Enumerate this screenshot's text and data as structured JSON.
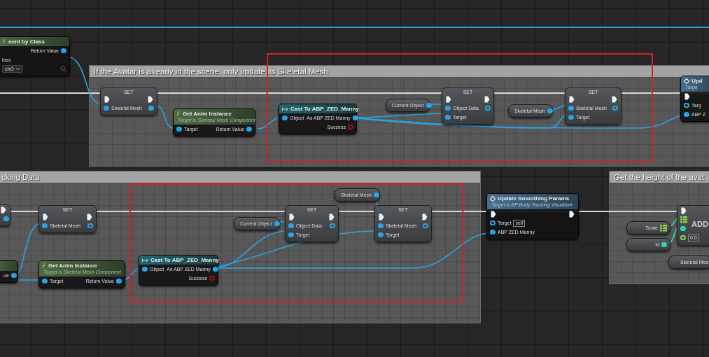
{
  "comments": [
    {
      "title": "If the Avatar is already in the scene, only update its Skeletal Mesh"
    },
    {
      "title": "cking Data"
    },
    {
      "title": "Get the height of the avat"
    }
  ],
  "nodes": [
    {
      "kind": "function",
      "title": "nent by Class",
      "exec_in": false,
      "exec_out": false,
      "rows": [
        {
          "out": {
            "label": "Return Value",
            "kind": "dot",
            "color": "#28a4e6",
            "connected": true
          }
        },
        {
          "in": {
            "label": "lass"
          }
        },
        {
          "dropdown": "chO"
        }
      ]
    },
    {
      "kind": "set",
      "title": "SET",
      "exec_in": true,
      "exec_out": true,
      "rows": [
        {
          "in": {
            "label": "Skeletal Mesh",
            "kind": "dot",
            "color": "#28a4e6",
            "connected": true
          },
          "out": {
            "kind": "dot",
            "color": "#28a4e6",
            "connected": true
          }
        }
      ]
    },
    {
      "kind": "function",
      "title": "Get Anim Instance",
      "subtitle": "Target is Skeletal Mesh Component",
      "exec_in": false,
      "exec_out": false,
      "rows": [
        {
          "in": {
            "label": "Target",
            "kind": "dot",
            "color": "#28a4e6",
            "connected": true
          },
          "out": {
            "label": "Return Value",
            "kind": "dot",
            "color": "#28a4e6",
            "connected": true
          }
        }
      ]
    },
    {
      "kind": "cast",
      "title": "Cast To ABP_ZED_Manny",
      "exec_in": false,
      "exec_out": false,
      "rows": [
        {
          "in": {
            "label": "Object",
            "kind": "dot",
            "color": "#28a4e6",
            "connected": true
          },
          "out": {
            "label": "As ABP ZED Manny",
            "kind": "dot",
            "color": "#28a4e6",
            "connected": true
          }
        },
        {
          "out": {
            "label": "Success",
            "kind": "dot",
            "color": "#9a1010",
            "connected": false
          }
        }
      ]
    },
    {
      "kind": "variable",
      "exec_in": false,
      "exec_out": false,
      "rows": [
        {
          "out": {
            "label": "Current Object",
            "kind": "dot",
            "color": "#28a4e6",
            "connected": true
          }
        }
      ]
    },
    {
      "kind": "set",
      "title": "SET",
      "exec_in": true,
      "exec_out": true,
      "rows": [
        {
          "in": {
            "label": "Object Data",
            "kind": "dot",
            "color": "#28a4e6",
            "connected": true
          },
          "out": {
            "kind": "dot",
            "color": "#28a4e6",
            "connected": false
          }
        },
        {
          "in": {
            "label": "Target",
            "kind": "dot",
            "color": "#28a4e6",
            "connected": true
          }
        }
      ]
    },
    {
      "kind": "variable",
      "exec_in": false,
      "exec_out": false,
      "rows": [
        {
          "out": {
            "label": "Skeletal Mesh",
            "kind": "dot",
            "color": "#28a4e6",
            "connected": true
          }
        }
      ]
    },
    {
      "kind": "set",
      "title": "SET",
      "exec_in": true,
      "exec_out": true,
      "rows": [
        {
          "in": {
            "label": "Skeletal Mesh",
            "kind": "dot",
            "color": "#28a4e6",
            "connected": true
          },
          "out": {
            "kind": "dot",
            "color": "#28a4e6",
            "connected": false
          }
        },
        {
          "in": {
            "label": "Target",
            "kind": "dot",
            "color": "#28a4e6",
            "connected": true
          }
        }
      ]
    },
    {
      "kind": "custom",
      "title": "Upd",
      "subtitle": "Targe",
      "exec_in": true,
      "exec_out": false,
      "rows": [
        {
          "in": {
            "label": "Targ",
            "kind": "dot",
            "color": "#28a4e6",
            "connected": false
          }
        },
        {
          "in": {
            "label": "ABP Z",
            "kind": "dot",
            "color": "#28a4e6",
            "connected": true
          }
        }
      ]
    },
    {
      "kind": "set",
      "exec_in": false,
      "exec_out": true,
      "rows": [
        {
          "out": {
            "kind": "dot",
            "color": "#28a4e6",
            "connected": true
          }
        }
      ]
    },
    {
      "kind": "function",
      "exec_in": false,
      "exec_out": false,
      "rows": [
        {
          "out": {
            "label": "ue",
            "kind": "dot",
            "color": "#28a4e6",
            "connected": true
          }
        }
      ]
    },
    {
      "kind": "set",
      "title": "SET",
      "exec_in": true,
      "exec_out": true,
      "rows": [
        {
          "in": {
            "label": "Skeletal Mesh",
            "kind": "dot",
            "color": "#28a4e6",
            "connected": true
          },
          "out": {
            "kind": "dot",
            "color": "#28a4e6",
            "connected": false
          }
        }
      ]
    },
    {
      "kind": "function",
      "title": "Get Anim Instance",
      "subtitle": "Target is Skeletal Mesh Component",
      "exec_in": false,
      "exec_out": false,
      "rows": [
        {
          "in": {
            "label": "Target",
            "kind": "dot",
            "color": "#28a4e6",
            "connected": true
          },
          "out": {
            "label": "Return Value",
            "kind": "dot",
            "color": "#28a4e6",
            "connected": true
          }
        }
      ]
    },
    {
      "kind": "cast",
      "title": "Cast To ABP_ZED_Manny",
      "exec_in": false,
      "exec_out": false,
      "rows": [
        {
          "in": {
            "label": "Object",
            "kind": "dot",
            "color": "#28a4e6",
            "connected": true
          },
          "out": {
            "label": "As ABP ZED Manny",
            "kind": "dot",
            "color": "#28a4e6",
            "connected": true
          }
        },
        {
          "out": {
            "label": "Success",
            "kind": "dot",
            "color": "#9a1010",
            "connected": false
          }
        }
      ]
    },
    {
      "kind": "variable",
      "exec_in": false,
      "exec_out": false,
      "rows": [
        {
          "out": {
            "label": "Current Object",
            "kind": "dot",
            "color": "#28a4e6",
            "connected": true
          }
        }
      ]
    },
    {
      "kind": "set",
      "title": "SET",
      "exec_in": true,
      "exec_out": true,
      "rows": [
        {
          "in": {
            "label": "Object Data",
            "kind": "dot",
            "color": "#28a4e6",
            "connected": true
          },
          "out": {
            "kind": "dot",
            "color": "#28a4e6",
            "connected": false
          }
        },
        {
          "in": {
            "label": "Target",
            "kind": "dot",
            "color": "#28a4e6",
            "connected": true
          }
        }
      ]
    },
    {
      "kind": "variable",
      "exec_in": false,
      "exec_out": false,
      "rows": [
        {
          "out": {
            "label": "Skeletal Mesh",
            "kind": "dot",
            "color": "#28a4e6",
            "connected": true
          }
        }
      ]
    },
    {
      "kind": "set",
      "title": "SET",
      "exec_in": true,
      "exec_out": true,
      "rows": [
        {
          "in": {
            "label": "Skeletal Mesh",
            "kind": "dot",
            "color": "#28a4e6",
            "connected": true
          },
          "out": {
            "kind": "dot",
            "color": "#28a4e6",
            "connected": false
          }
        },
        {
          "in": {
            "label": "Target",
            "kind": "dot",
            "color": "#28a4e6",
            "connected": true
          }
        }
      ]
    },
    {
      "kind": "custom",
      "title": "Update Smoothing Params",
      "subtitle": "Target is BP Body Tracking Visualizer",
      "exec_in": true,
      "exec_out": true,
      "rows": [
        {
          "in": {
            "label": "Target",
            "kind": "dot",
            "color": "#28a4e6",
            "connected": false,
            "default": "self"
          }
        },
        {
          "in": {
            "label": "ABP ZED Manny",
            "kind": "dot",
            "color": "#28a4e6",
            "connected": true
          }
        }
      ]
    },
    {
      "kind": "variable",
      "exec_in": false,
      "exec_out": false,
      "rows": [
        {
          "out": {
            "label": "Scale",
            "kind": "array",
            "color": "#8fd14f",
            "connected": true
          }
        }
      ]
    },
    {
      "kind": "variable",
      "exec_in": false,
      "exec_out": false,
      "rows": [
        {
          "out": {
            "label": "Id",
            "kind": "dot",
            "color": "#27d9b0",
            "connected": true
          }
        }
      ]
    },
    {
      "kind": "add",
      "title": "ADD",
      "exec_in": true,
      "exec_out": false,
      "rows": [
        {
          "in": {
            "kind": "array",
            "color": "#8fd14f",
            "connected": true
          }
        },
        {
          "in": {
            "kind": "dot",
            "color": "#27d9b0",
            "connected": true
          }
        },
        {
          "in": {
            "kind": "dot",
            "color": "#8fd14f",
            "connected": false,
            "default": "0.0"
          }
        }
      ]
    },
    {
      "kind": "variable",
      "exec_in": false,
      "exec_out": false,
      "rows": [
        {
          "out": {
            "label": "Skeletal Mes"
          }
        }
      ]
    }
  ]
}
